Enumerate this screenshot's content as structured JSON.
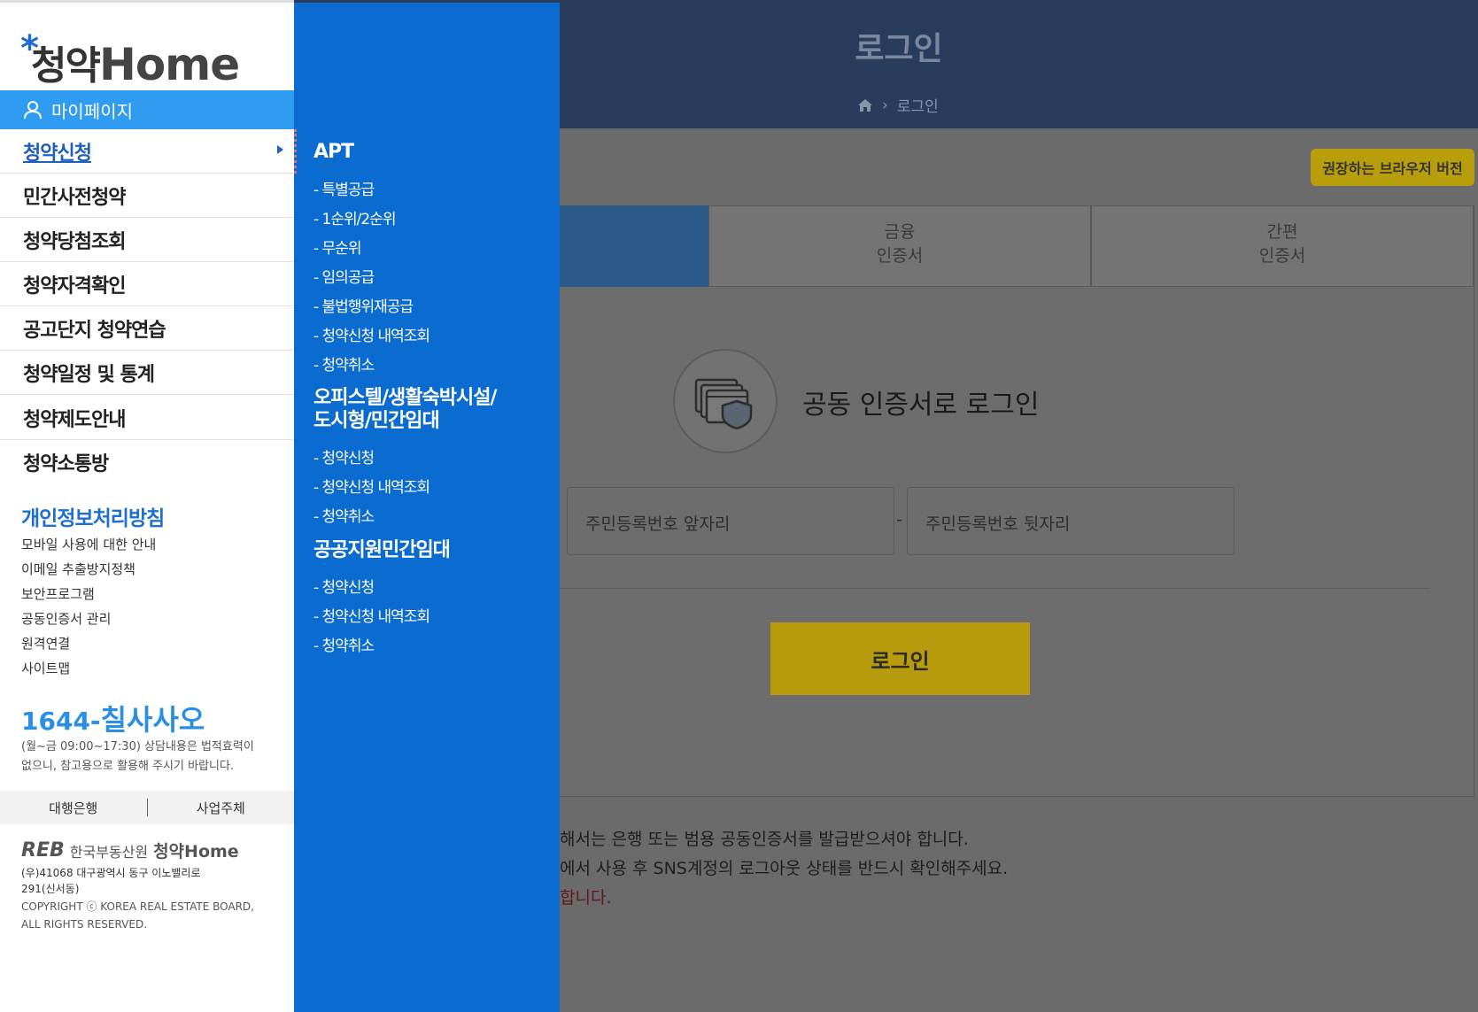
{
  "background_page": {
    "title": "로그인",
    "breadcrumb": "로그인",
    "browser_button": "권장하는 브라우저 버전",
    "tabs": [
      {
        "line1": "금융",
        "line2": "인증서"
      },
      {
        "line1": "간편",
        "line2": "인증서"
      }
    ],
    "cert_login_text": "공동 인증서로 로그인",
    "rrn_front_placeholder": "주민등록번호 앞자리",
    "rrn_separator": "-",
    "rrn_back_placeholder": "주민등록번호 뒷자리",
    "login_button": "로그인",
    "notes": [
      "해서는 은행 또는 범용 공동인증서를 발급받으셔야 합니다.",
      "에서 사용 후 SNS계정의 로그아웃 상태를 반드시 확인해주세요.",
      "합니다."
    ]
  },
  "sidebar": {
    "logo": {
      "star": "*",
      "ko": "청약",
      "en": "Home"
    },
    "mypage": "마이페이지",
    "menu": [
      {
        "label": "청약신청",
        "active": true
      },
      {
        "label": "민간사전청약"
      },
      {
        "label": "청약당첨조회"
      },
      {
        "label": "청약자격확인"
      },
      {
        "label": "공고단지 청약연습"
      },
      {
        "label": "청약일정 및 통계"
      },
      {
        "label": "청약제도안내"
      },
      {
        "label": "청약소통방"
      }
    ],
    "privacy": "개인정보처리방침",
    "links": [
      "모바일 사용에 대한 안내",
      "이메일 추출방지정책",
      "보안프로그램",
      "공동인증서 관리",
      "원격연결",
      "사이트맵"
    ],
    "phone_prefix": "1644-",
    "phone_word": "칠사사오",
    "hours_line1": "(월~금 09:00~17:30) 상담내용은 법적효력이",
    "hours_line2": "없으니, 참고용으로 활용해 주시기 바랍니다.",
    "bottom_tabs": [
      "대행은행",
      "사업주체"
    ],
    "reb_mark": "REB",
    "reb_name": "한국부동산원",
    "reb_home": "청약Home",
    "address_line1": "(우)41068 대구광역시 동구 이노밸리로",
    "address_line2": "291(신서동)",
    "copyright_line1": "COPYRIGHT ⓒ KOREA REAL ESTATE BOARD,",
    "copyright_line2": "ALL RIGHTS RESERVED."
  },
  "submenu": {
    "apt_head": "APT",
    "apt_items": [
      "- 특별공급",
      "- 1순위/2순위",
      "- 무순위",
      "- 임의공급",
      "- 불법행위재공급",
      "- 청약신청 내역조회",
      "- 청약취소"
    ],
    "officetel_head_1": "오피스텔/생활숙박시설/",
    "officetel_head_2": "도시형/민간임대",
    "officetel_items": [
      "- 청약신청",
      "- 청약신청 내역조회",
      "- 청약취소"
    ],
    "public_head": "공공지원민간임대",
    "public_items": [
      "- 청약신청",
      "- 청약신청 내역조회",
      "- 청약취소"
    ]
  },
  "colors": {
    "sidebar_accent": "#2f9cf2",
    "submenu_bg": "#0a6bd0",
    "phone": "#2a8ee6"
  }
}
